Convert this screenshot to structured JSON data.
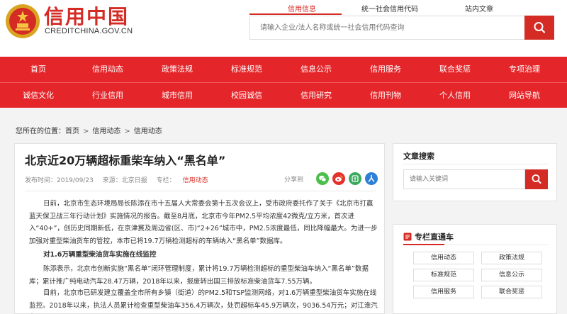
{
  "header": {
    "logo_text": "信用中国",
    "logo_domain": "CREDITCHINA.GOV.CN",
    "search_tabs": [
      "信用信息",
      "统一社会信用代码",
      "站内文章"
    ],
    "search_placeholder": "请输入企业/法人名称或统一社会信用代码查询",
    "accent_color": "#d42c24"
  },
  "nav": {
    "row1": [
      "首页",
      "信用动态",
      "政策法规",
      "标准规范",
      "信息公示",
      "信用服务",
      "联合奖惩",
      "专项治理"
    ],
    "row2": [
      "诚信文化",
      "行业信用",
      "城市信用",
      "校园诚信",
      "信用研究",
      "信用刊物",
      "个人信用",
      "网站导航"
    ],
    "background_color": "#e4262a"
  },
  "breadcrumb": {
    "prefix": "您所在的位置：",
    "items": [
      "首页",
      "信用动态",
      "信用动态"
    ],
    "separator": ">"
  },
  "article": {
    "title": "北京近20万辆超标重柴车纳入“黑名单”",
    "publish_time": "发布时间：2019/09/23",
    "source": "来源：北京日报",
    "column_label": "专栏：",
    "column_name": "信用动态",
    "share_label": "分享到",
    "share_icons": [
      "wechat-icon",
      "weibo-icon",
      "tieba-icon",
      "renren-icon"
    ],
    "paragraphs": [
      "日前，北京市生态环境局局长陈添在市十五届人大常委会第十五次会议上，受市政府委托作了关于《北京市打赢蓝天保卫战三年行动计划》实施情况的报告。截至8月底，北京市今年PM2.5平均浓度42微克/立方米，首次进入“40+”，创历史同期新低，在京津冀及周边省(区、市)“2+26”城市中，PM2.5浓度最低，同比降幅最大。为进一步加强对重型柴油货车的管控，本市已将19.7万辆检测超标的车辆纳入“黑名单”数据库。",
      "对1.6万辆重型柴油货车实施在线监控",
      "陈添表示，北京市创新实施“黑名单”闭环管理制度，累计将19.7万辆检测超标的重型柴油车纳入“黑名单”数据库；累计推广纯电动汽车28.47万辆，2018年以来，报废转出国三排放标准柴油货车7.55万辆。",
      "目前，北京市已研发建立覆盖全市所有乡镇（街道）的PM2.5和TSP监测网络，对1.6万辆重型柴油货车实施在线监控。2018年以来，执法人员累计检查重型柴油车356.4万辆次，处罚超标车45.9万辆次，9036.54万元；对江淮汽车"
    ]
  },
  "sidebar": {
    "search_title": "文章搜索",
    "search_placeholder": "请输入关键词",
    "column_title": "专栏直通车",
    "column_items": [
      "信用动态",
      "政策法规",
      "标准规范",
      "信息公示",
      "信用服务",
      "联合奖惩"
    ]
  }
}
